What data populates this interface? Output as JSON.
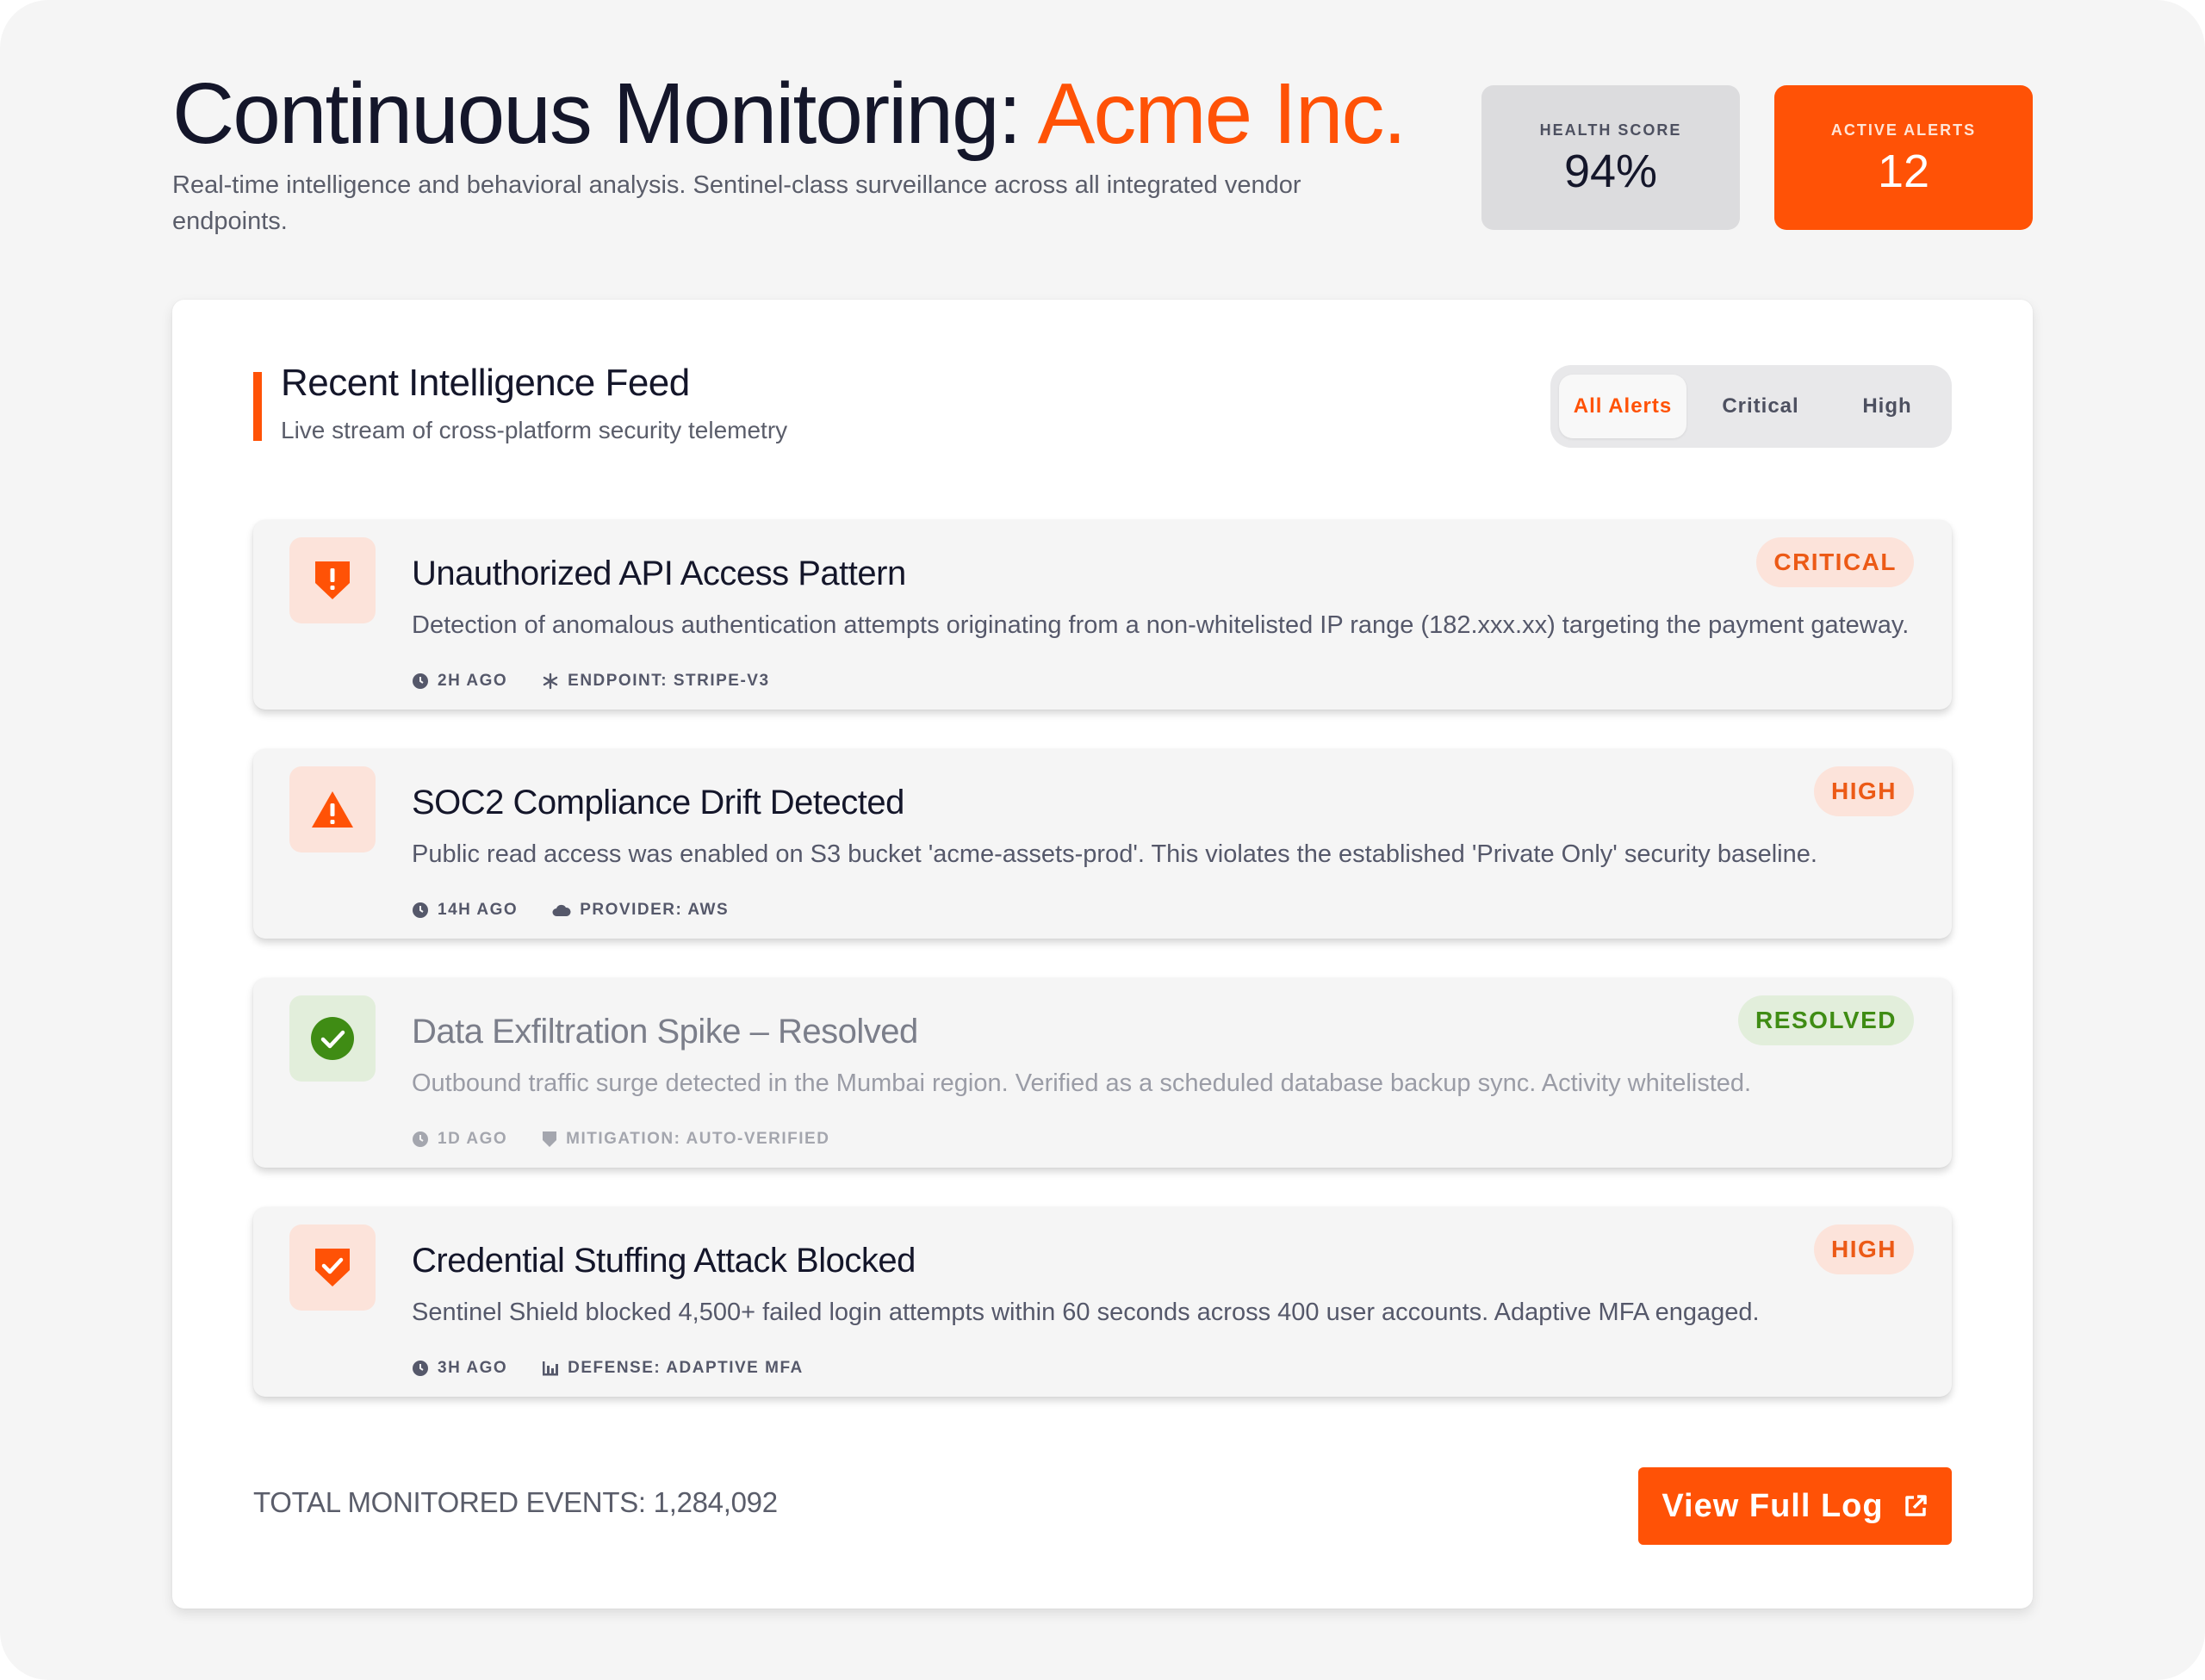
{
  "header": {
    "title_prefix": "Continuous Monitoring: ",
    "company": "Acme Inc.",
    "subtitle": "Real-time intelligence and behavioral analysis. Sentinel-class surveillance across all integrated vendor endpoints."
  },
  "stats": {
    "health": {
      "label": "HEALTH SCORE",
      "value": "94%"
    },
    "alerts": {
      "label": "ACTIVE ALERTS",
      "value": "12"
    }
  },
  "feed": {
    "title": "Recent Intelligence Feed",
    "subtitle": "Live stream of cross-platform security telemetry",
    "filters": [
      "All Alerts",
      "Critical",
      "High"
    ],
    "active_filter": "All Alerts"
  },
  "alerts": [
    {
      "icon": "shield-exclamation-icon",
      "title": "Unauthorized API Access Pattern",
      "description": "Detection of anomalous authentication attempts originating from a non-whitelisted IP range (182.xxx.xx) targeting the payment gateway.",
      "time": "2H AGO",
      "meta_icon": "asterisk-icon",
      "meta": "ENDPOINT: STRIPE-V3",
      "badge": "CRITICAL",
      "status": "critical"
    },
    {
      "icon": "warning-triangle-icon",
      "title": "SOC2 Compliance Drift Detected",
      "description": "Public read access was enabled on S3 bucket 'acme-assets-prod'. This violates the established 'Private Only' security baseline.",
      "time": "14H AGO",
      "meta_icon": "cloud-icon",
      "meta": "PROVIDER: AWS",
      "badge": "HIGH",
      "status": "high"
    },
    {
      "icon": "check-circle-icon",
      "title": "Data Exfiltration Spike – Resolved",
      "description": "Outbound traffic surge detected in the Mumbai region. Verified as a scheduled database backup sync. Activity whitelisted.",
      "time": "1D AGO",
      "meta_icon": "shield-icon",
      "meta": "MITIGATION: AUTO-VERIFIED",
      "badge": "RESOLVED",
      "status": "resolved"
    },
    {
      "icon": "shield-check-icon",
      "title": "Credential Stuffing Attack Blocked",
      "description": "Sentinel Shield blocked 4,500+ failed login attempts within 60 seconds across 400 user accounts. Adaptive MFA engaged.",
      "time": "3H AGO",
      "meta_icon": "bar-chart-icon",
      "meta": "DEFENSE: ADAPTIVE MFA",
      "badge": "HIGH",
      "status": "high"
    }
  ],
  "footer": {
    "total": "TOTAL MONITORED EVENTS: 1,284,092",
    "button": "View Full Log"
  },
  "colors": {
    "accent": "#ff5206",
    "background": "#f5f5f5",
    "resolved_green": "#3f8c14",
    "text_dark": "#14162a"
  }
}
